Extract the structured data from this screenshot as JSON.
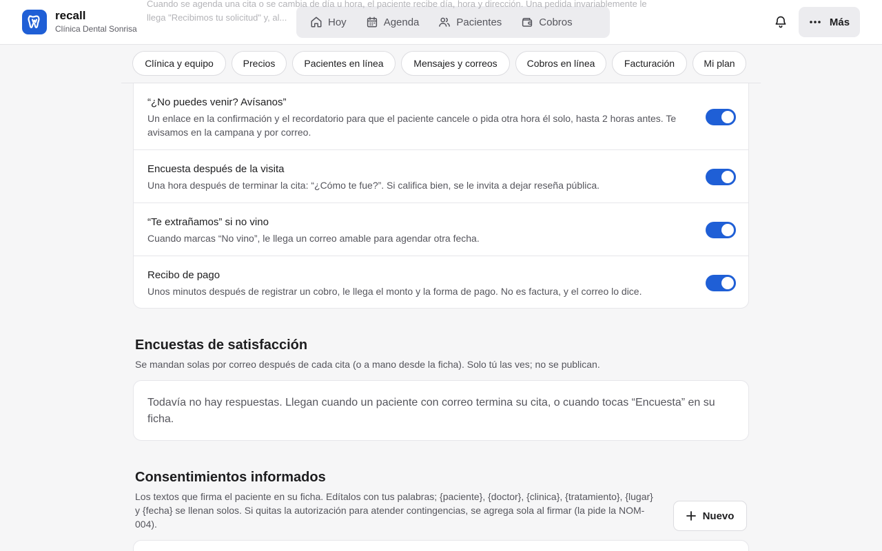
{
  "app": {
    "name": "recall",
    "clinic": "Clínica Dental Sonrisa"
  },
  "nav": {
    "items": [
      {
        "label": "Hoy",
        "icon": "home-icon"
      },
      {
        "label": "Agenda",
        "icon": "calendar-icon"
      },
      {
        "label": "Pacientes",
        "icon": "users-icon"
      },
      {
        "label": "Cobros",
        "icon": "wallet-icon"
      }
    ],
    "more_label": "Más"
  },
  "peek": {
    "line1": "Cuando se agenda una cita o se cambia de día u hora, el paciente recibe día, hora y dirección. Una pedida invariablemente le",
    "line2": "llega \"Recibimos tu solicitud\" y, al..."
  },
  "subnav": {
    "tabs": [
      "Clínica y equipo",
      "Precios",
      "Pacientes en línea",
      "Mensajes y correos",
      "Cobros en línea",
      "Facturación",
      "Mi plan"
    ]
  },
  "notifications": {
    "rows": [
      {
        "title": "“¿No puedes venir? Avísanos”",
        "desc": "Un enlace en la confirmación y el recordatorio para que el paciente cancele o pida otra hora él solo, hasta 2 horas antes. Te avisamos en la campana y por correo.",
        "enabled": true
      },
      {
        "title": "Encuesta después de la visita",
        "desc": "Una hora después de terminar la cita: “¿Cómo te fue?”. Si califica bien, se le invita a dejar reseña pública.",
        "enabled": true
      },
      {
        "title": "“Te extrañamos” si no vino",
        "desc": "Cuando marcas “No vino”, le llega un correo amable para agendar otra fecha.",
        "enabled": true
      },
      {
        "title": "Recibo de pago",
        "desc": "Unos minutos después de registrar un cobro, le llega el monto y la forma de pago. No es factura, y el correo lo dice.",
        "enabled": true
      }
    ]
  },
  "surveys": {
    "title": "Encuestas de satisfacción",
    "subtitle": "Se mandan solas por correo después de cada cita (o a mano desde la ficha). Solo tú las ves; no se publican.",
    "empty": "Todavía no hay respuestas. Llegan cuando un paciente con correo termina su cita, o cuando tocas “Encuesta” en su ficha."
  },
  "consents": {
    "title": "Consentimientos informados",
    "subtitle": "Los textos que firma el paciente en su ficha. Edítalos con tus palabras; {paciente}, {doctor}, {clinica}, {tratamiento}, {lugar} y {fecha} se llenan solos. Si quitas la autorización para atender contingencias, se agrega sola al firmar (la pide la NOM-004).",
    "new_label": "Nuevo"
  },
  "colors": {
    "accent": "#1f5fd6",
    "background": "#f6f6f7"
  }
}
